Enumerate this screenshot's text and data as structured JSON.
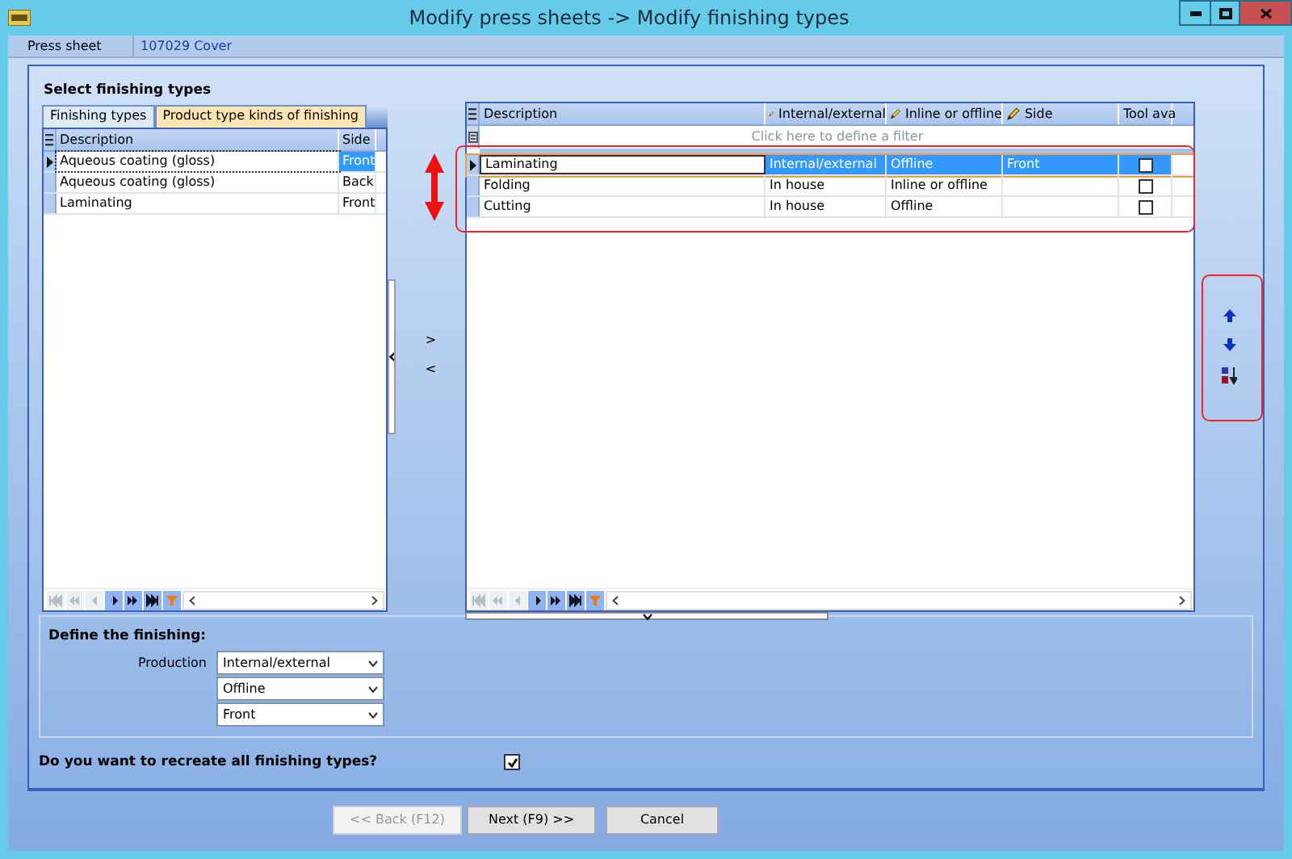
{
  "window": {
    "title": "Modify press sheets -> Modify finishing types"
  },
  "info_bar": {
    "label": "Press sheet",
    "value": "107029 Cover"
  },
  "heading": "Select finishing types",
  "tabs": [
    {
      "label": "Finishing types",
      "selected": false
    },
    {
      "label": "Product type kinds of finishing",
      "selected": true
    }
  ],
  "left_grid": {
    "columns": [
      "Description",
      "Side"
    ],
    "rows": [
      {
        "description": "Aqueous coating (gloss)",
        "side": "Front",
        "selected": true
      },
      {
        "description": "Aqueous coating (gloss)",
        "side": "Back",
        "selected": false
      },
      {
        "description": "Laminating",
        "side": "Front",
        "selected": false
      }
    ],
    "navigator": [
      {
        "kind": "first",
        "disabled": true
      },
      {
        "kind": "prev_page",
        "disabled": true
      },
      {
        "kind": "prev",
        "disabled": true
      },
      {
        "kind": "next",
        "disabled": false
      },
      {
        "kind": "next_page",
        "disabled": false
      },
      {
        "kind": "last",
        "disabled": false
      },
      {
        "kind": "filter",
        "disabled": false
      }
    ]
  },
  "move_buttons": [
    ">",
    "<"
  ],
  "right_grid": {
    "columns": [
      {
        "label": "Description",
        "editable": false
      },
      {
        "label": "Internal/external",
        "editable": true
      },
      {
        "label": "Inline or offline",
        "editable": true
      },
      {
        "label": "Side",
        "editable": true
      },
      {
        "label": "Tool ava",
        "editable": false
      }
    ],
    "filter_placeholder": "Click here to define a filter",
    "rows": [
      {
        "description": "Laminating",
        "production": "Internal/external",
        "inline": "Offline",
        "side": "Front",
        "tool_available": false,
        "selected": true
      },
      {
        "description": "Folding",
        "production": "In house",
        "inline": "Inline or offline",
        "side": "",
        "tool_available": false,
        "selected": false
      },
      {
        "description": "Cutting",
        "production": "In house",
        "inline": "Offline",
        "side": "",
        "tool_available": false,
        "selected": false
      }
    ],
    "navigator": [
      {
        "kind": "first",
        "disabled": true
      },
      {
        "kind": "prev_page",
        "disabled": true
      },
      {
        "kind": "prev",
        "disabled": true
      },
      {
        "kind": "next",
        "disabled": false
      },
      {
        "kind": "next_page",
        "disabled": false
      },
      {
        "kind": "last",
        "disabled": false
      },
      {
        "kind": "filter",
        "disabled": false
      }
    ]
  },
  "define": {
    "heading": "Define the finishing:",
    "label": "Production",
    "selects": [
      "Internal/external",
      "Offline",
      "Front"
    ]
  },
  "question": {
    "text": "Do you want to recreate all finishing types?",
    "checked": true
  },
  "buttons": [
    {
      "label": "<< Back (F12)",
      "disabled": true
    },
    {
      "label": "Next (F9) >>",
      "disabled": false
    },
    {
      "label": "Cancel",
      "disabled": false
    }
  ]
}
